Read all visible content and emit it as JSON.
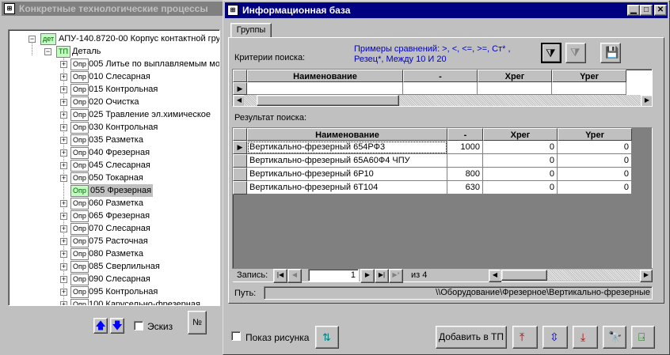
{
  "back_window": {
    "title": "Конкретные технологические процессы",
    "tree": {
      "root": {
        "tag": "дет",
        "label": "АПУ-140.8720-00 Корпус контактной гру"
      },
      "child": {
        "tag": "ТП",
        "label": "Деталь"
      },
      "ops": [
        {
          "tag": "Опр",
          "label": "005 Литье по выплавляемым мо"
        },
        {
          "tag": "Опр",
          "label": "010 Слесарная"
        },
        {
          "tag": "Опр",
          "label": "015 Контрольная"
        },
        {
          "tag": "Опр",
          "label": "020 Очистка"
        },
        {
          "tag": "Опр",
          "label": "025 Травление эл.химическое"
        },
        {
          "tag": "Опр",
          "label": "030 Контрольная"
        },
        {
          "tag": "Опр",
          "label": "035 Разметка"
        },
        {
          "tag": "Опр",
          "label": "040 Фрезерная"
        },
        {
          "tag": "Опр",
          "label": "045 Слесарная"
        },
        {
          "tag": "Опр",
          "label": "050 Токарная"
        },
        {
          "tag": "Опр",
          "label": "055 Фрезерная"
        },
        {
          "tag": "Опр",
          "label": "060 Разметка"
        },
        {
          "tag": "Опр",
          "label": "065 Фрезерная"
        },
        {
          "tag": "Опр",
          "label": "070 Слесарная"
        },
        {
          "tag": "Опр",
          "label": "075 Расточная"
        },
        {
          "tag": "Опр",
          "label": "080 Разметка"
        },
        {
          "tag": "Опр",
          "label": "085 Сверлильная"
        },
        {
          "tag": "Опр",
          "label": "090 Слесарная"
        },
        {
          "tag": "Опр",
          "label": "095 Контрольная"
        },
        {
          "tag": "Опр",
          "label": "100 Карусельно-фрезерная"
        }
      ]
    },
    "eskiz_label": "Эскиз",
    "num_button": "№"
  },
  "front_window": {
    "title": "Информационная база",
    "tab_label": "Группы",
    "criteria_label": "Критерии поиска:",
    "examples_text_1": "Примеры сравнений: >, <, <=, >=, Ст* ,",
    "examples_text_2": "Резец*,  Между 10 И 20",
    "criteria_grid": {
      "headers": [
        "Наименование",
        "-",
        "Xpег",
        "Yper"
      ]
    },
    "results_label": "Результат поиска:",
    "results_grid": {
      "headers": [
        "Наименование",
        "-",
        "Xpег",
        "Yper"
      ],
      "rows": [
        {
          "name": "Вертикально-фрезерный 654РФ3",
          "dash": "1000",
          "x": "0",
          "y": "0"
        },
        {
          "name": "Вертикально-фрезерный 65А60Ф4 ЧПУ",
          "dash": "",
          "x": "0",
          "y": "0"
        },
        {
          "name": "Вертикально-фрезерный 6Р10",
          "dash": "800",
          "x": "0",
          "y": "0"
        },
        {
          "name": "Вертикально-фрезерный 6Т104",
          "dash": "630",
          "x": "0",
          "y": "0"
        }
      ]
    },
    "record_label": "Запись:",
    "record_value": "1",
    "record_of": "из  4",
    "path_label": "Путь:",
    "path_value": "\\\\Оборудование\\Фрезерное\\Вертикально-фрезерные",
    "show_picture_label": "Показ рисунка",
    "add_to_tp_button": "Добавить в ТП"
  }
}
